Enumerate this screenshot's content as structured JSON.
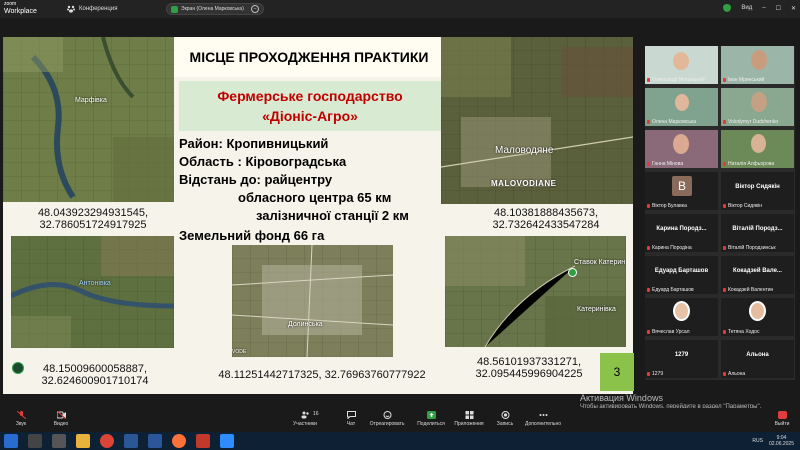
{
  "app": {
    "logo_line1": "zoom",
    "logo_line2": "Workplace",
    "conference_label": "Конференция",
    "share_label": "Экран (Олена Марковська)",
    "view_label": "Вид"
  },
  "slide": {
    "title": "МІСЦЕ ПРОХОДЖЕННЯ ПРАКТИКИ",
    "farm_line1": "Фермерське господарство",
    "farm_line2": "«Діоніс-Агро»",
    "district": "Район:  Кропивницький",
    "region": "Область : Кіровоградська",
    "distance": "Відстань до: райцентру",
    "distance_center": "обласного центра 65 км",
    "distance_station": "залізничної станції  2 км",
    "land": "Земельний фонд 66 га",
    "page_number": "3",
    "maps": {
      "marfivka": "Марфівка",
      "malovodiane": "Маловодяне",
      "malovodiane_en": "MALOVODIANE",
      "antonivka": "Антонівка",
      "dolynska": "Долинська",
      "vode": "VODE",
      "katerynka_pond": "Ставок Катерин",
      "katerynivka": "Катеринівка"
    },
    "coords": {
      "c1_line1": "48.043923294931545,",
      "c1_line2": "32.786051724917925",
      "c2_line1": "48.10381888435673,",
      "c2_line2": "32.732642433547284",
      "c3_line1": "48.15009600058887,",
      "c3_line2": "32.624600901710174",
      "c4": "48.11251442717325, 32.76963760777922",
      "c5_line1": "48.56101937331271,",
      "c5_line2": "32.095445996904225"
    }
  },
  "participants": [
    {
      "name": "Олександр Мотальний"
    },
    {
      "name": "Іван Мринський"
    },
    {
      "name": "Олена Марковська"
    },
    {
      "name": "Volodymyr Dudchenko"
    },
    {
      "name": "Ганна Мінова"
    },
    {
      "name": "Наталія Алфьорова"
    },
    {
      "name": "Віктор Булавка",
      "initial": "В"
    },
    {
      "name": "Віктор Сидякін",
      "big": "Віктор Сидякін"
    },
    {
      "name": "Карина Породіна",
      "big": "Карина  Породз..."
    },
    {
      "name": "Віталій Породзинськ",
      "big": "Віталій  Породз..."
    },
    {
      "name": "Едуард Барташов",
      "big": "Едуард Барташов"
    },
    {
      "name": "Кокадзей Валентин",
      "big": "Кокадзей  Вале..."
    },
    {
      "name": "Вячеслав Урсал"
    },
    {
      "name": "Тетяна Ходос"
    },
    {
      "name": "1279",
      "big": "1279"
    },
    {
      "name": "Альона",
      "big": "Альона"
    }
  ],
  "activation": {
    "line1": "Активация Windows",
    "line2": "Чтобы активировать Windows, перейдите в раздел \"Параметры\"."
  },
  "toolbar": {
    "audio": "Звук",
    "video": "Видео",
    "participants": "Участники",
    "participants_count": "16",
    "chat": "Чат",
    "react": "Отреагировать",
    "share": "Поделиться",
    "apps": "Приложения",
    "record": "Запись",
    "more": "Дополнительно",
    "exit": "Выйти"
  },
  "taskbar": {
    "lang": "RUS",
    "time": "9:04",
    "date": "02.06.2025"
  },
  "colors": {
    "farm_title": "#c00000",
    "farm_box": "#d9ead3",
    "page_badge": "#8bc34a",
    "share_indicator": "#2ea043"
  }
}
